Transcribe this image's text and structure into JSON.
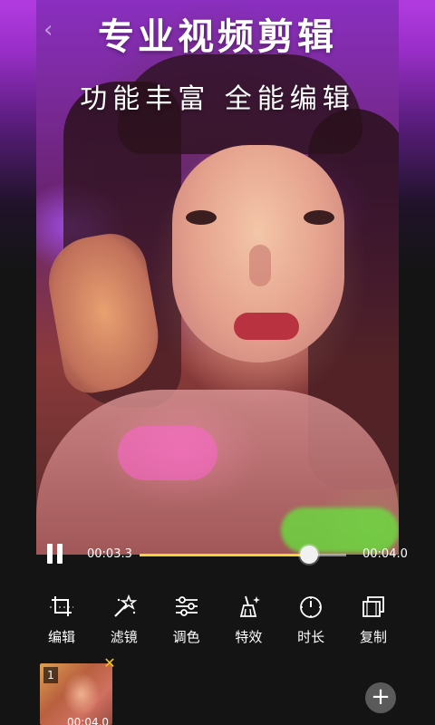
{
  "promo": {
    "headline": "专业视频剪辑",
    "subheadline": "功能丰富  全能编辑"
  },
  "playback": {
    "current_time": "00:03.3",
    "total_time": "00:04.0",
    "progress": 0.82,
    "state": "playing"
  },
  "tools": [
    {
      "label": "编辑",
      "icon": "crop-edit-icon"
    },
    {
      "label": "滤镜",
      "icon": "magic-wand-icon"
    },
    {
      "label": "调色",
      "icon": "sliders-icon"
    },
    {
      "label": "特效",
      "icon": "sparkle-broom-icon"
    },
    {
      "label": "时长",
      "icon": "timer-icon"
    },
    {
      "label": "复制",
      "icon": "copy-film-icon"
    }
  ],
  "clips": [
    {
      "index": "1",
      "duration": "00:04.0"
    }
  ],
  "colors": {
    "accent": "#f3d23a",
    "banner": "#b23be0",
    "background": "#141414"
  }
}
